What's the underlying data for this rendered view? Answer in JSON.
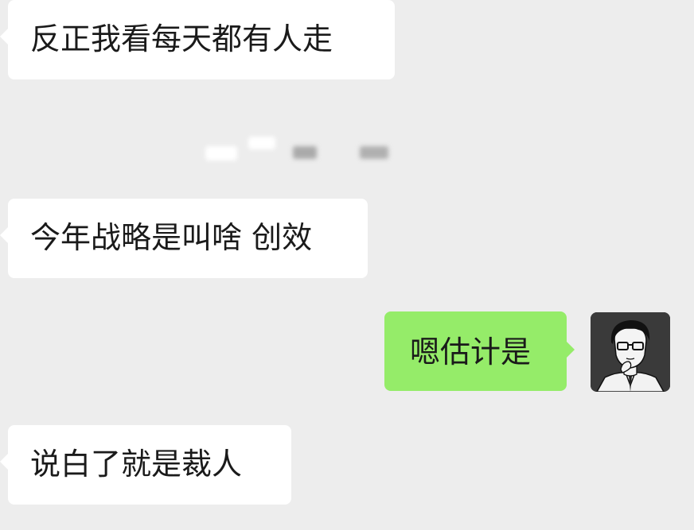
{
  "messages": [
    {
      "side": "incoming",
      "text": "反正我看每天都有人走"
    },
    {
      "side": "incoming",
      "text": "今年战略是叫啥 创效"
    },
    {
      "side": "outgoing",
      "text": "嗯估计是"
    },
    {
      "side": "incoming",
      "text": "说白了就是裁人"
    }
  ],
  "avatar": {
    "icon": "cartoon-man-glasses-avatar",
    "background": "#3a3a3a"
  },
  "colors": {
    "background": "#ededed",
    "incoming_bubble": "#ffffff",
    "outgoing_bubble": "#95ec69",
    "text": "#1a1a1a"
  }
}
